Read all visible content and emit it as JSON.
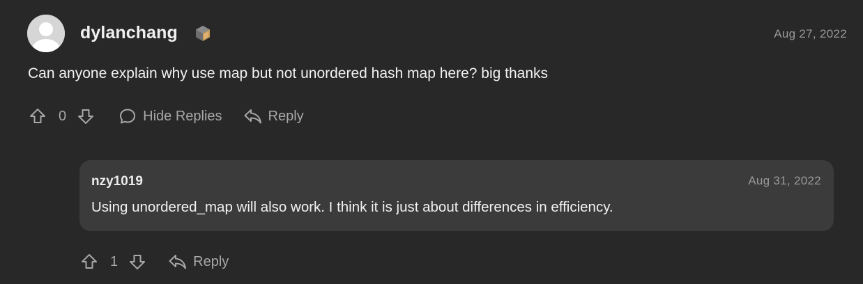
{
  "comment": {
    "username": "dylanchang",
    "date": "Aug 27, 2022",
    "text": "Can anyone explain why use map but not unordered hash map here? big thanks",
    "votes": "0",
    "hide_replies_label": "Hide Replies",
    "reply_label": "Reply"
  },
  "reply": {
    "username": "nzy1019",
    "date": "Aug 31, 2022",
    "text": "Using unordered_map will also work. I think it is just about differences in efficiency.",
    "votes": "1",
    "reply_label": "Reply"
  },
  "colors": {
    "background": "#282828",
    "card": "#3b3b3b",
    "muted": "#a8a8a8"
  },
  "icons": [
    "user-avatar-icon",
    "badge-icon",
    "upvote-icon",
    "downvote-icon",
    "comment-bubble-icon",
    "reply-arrow-icon"
  ]
}
